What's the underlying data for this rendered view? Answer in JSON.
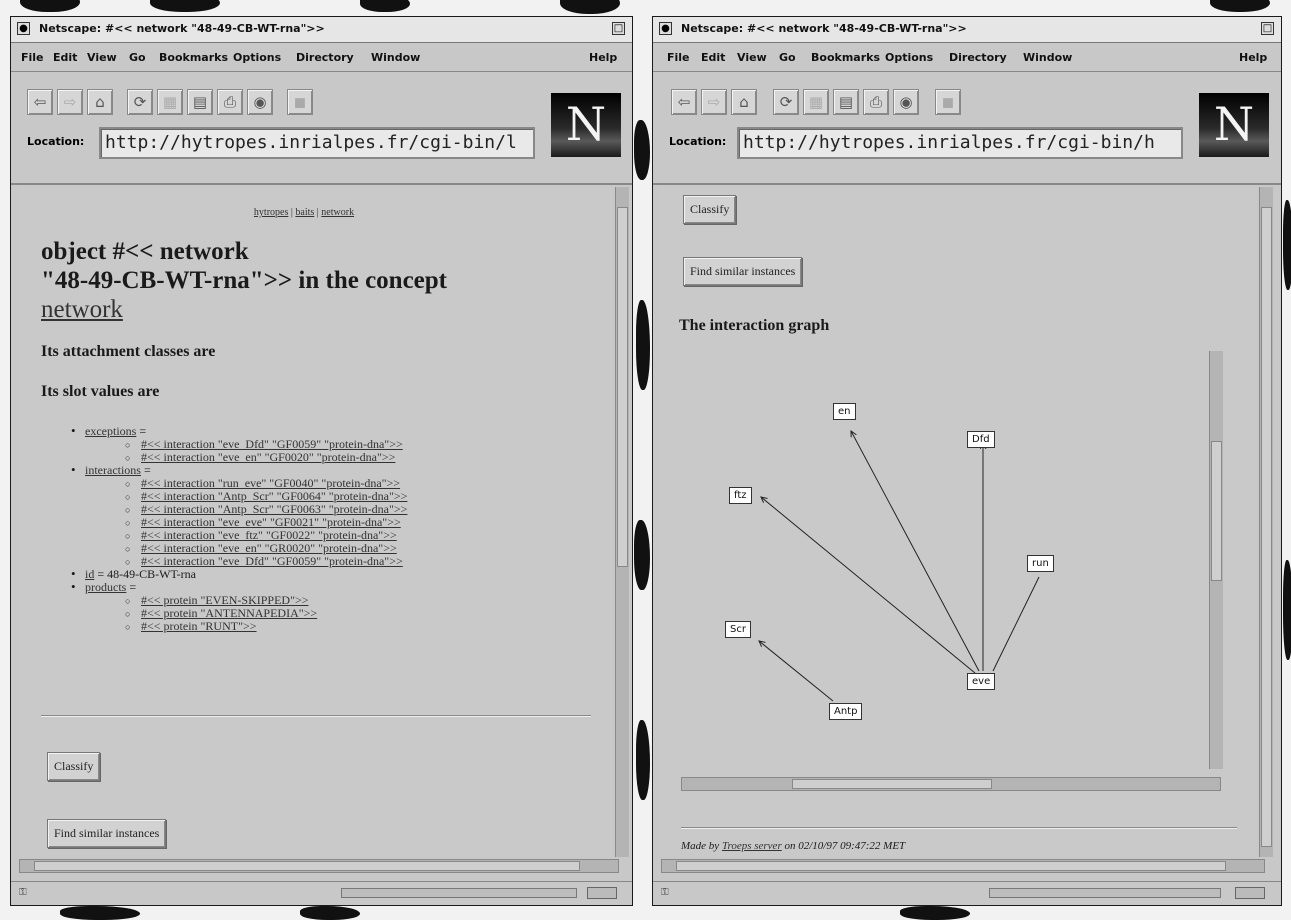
{
  "left_window": {
    "title": "Netscape: #<< network \"48-49-CB-WT-rna\">>",
    "menu": [
      "File",
      "Edit",
      "View",
      "Go",
      "Bookmarks",
      "Options",
      "Directory",
      "Window",
      "Help"
    ],
    "location_label": "Location:",
    "location_url": "http://hytropes.inrialpes.fr/cgi-bin/l",
    "breadcrumb": [
      "hytropes",
      "baits",
      "network"
    ],
    "heading_line1": "object #<< network",
    "heading_line2_text": "\"48-49-CB-WT-rna\">> in the concept",
    "heading_concept_link": "network",
    "attachment_heading": "Its attachment classes are",
    "slot_heading": "Its slot values are",
    "slots": {
      "exceptions_label": "exceptions",
      "exceptions": [
        "#<< interaction \"eve_Dfd\" \"GF0059\" \"protein-dna\">>",
        "#<< interaction \"eve_en\" \"GF0020\" \"protein-dna\">>"
      ],
      "interactions_label": "interactions",
      "interactions": [
        "#<< interaction \"run_eve\" \"GF0040\" \"protein-dna\">>",
        "#<< interaction \"Antp_Scr\" \"GF0064\" \"protein-dna\">>",
        "#<< interaction \"Antp_Scr\" \"GF0063\" \"protein-dna\">>",
        "#<< interaction \"eve_eve\" \"GF0021\" \"protein-dna\">>",
        "#<< interaction \"eve_ftz\" \"GF0022\" \"protein-dna\">>",
        "#<< interaction \"eve_en\" \"GR0020\" \"protein-dna\">>",
        "#<< interaction \"eve_Dfd\" \"GF0059\" \"protein-dna\">>"
      ],
      "id_label": "id",
      "id_value": "48-49-CB-WT-rna",
      "products_label": "products",
      "products": [
        "#<< protein \"EVEN-SKIPPED\">>",
        "#<< protein \"ANTENNAPEDIA\">>",
        "#<< protein \"RUNT\">>"
      ]
    },
    "classify_label": "Classify",
    "find_similar_label": "Find similar instances"
  },
  "right_window": {
    "title": "Netscape: #<< network \"48-49-CB-WT-rna\">>",
    "menu": [
      "File",
      "Edit",
      "View",
      "Go",
      "Bookmarks",
      "Options",
      "Directory",
      "Window",
      "Help"
    ],
    "location_label": "Location:",
    "location_url": "http://hytropes.inrialpes.fr/cgi-bin/h",
    "classify_label": "Classify",
    "find_similar_label": "Find similar instances",
    "graph_heading": "The interaction graph",
    "graph_nodes": [
      "en",
      "Dfd",
      "ftz",
      "run",
      "Scr",
      "eve",
      "Antp"
    ],
    "graph_edges": [
      [
        "eve",
        "en"
      ],
      [
        "eve",
        "Dfd"
      ],
      [
        "eve",
        "ftz"
      ],
      [
        "run",
        "eve"
      ],
      [
        "Antp",
        "Scr"
      ]
    ],
    "footer_prefix": "Made by ",
    "footer_link": "Troeps server",
    "footer_suffix": " on 02/10/97 09:47:22 MET"
  },
  "toolbar_icons": [
    "back-icon",
    "forward-icon",
    "home-icon",
    "reload-icon",
    "images-icon",
    "open-icon",
    "print-icon",
    "find-icon",
    "stop-icon"
  ],
  "logo_letter": "N"
}
